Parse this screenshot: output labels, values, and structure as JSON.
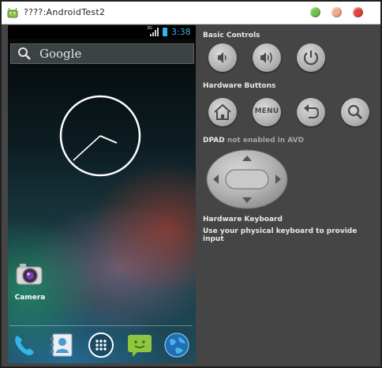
{
  "window": {
    "title": "????:AndroidTest2"
  },
  "statusbar": {
    "network": "3G",
    "time": "3:38"
  },
  "home": {
    "search_label": "Google",
    "camera_label": "Camera"
  },
  "dock": [
    "phone-icon",
    "contacts-icon",
    "app-drawer-icon",
    "messaging-icon",
    "browser-globe-icon"
  ],
  "controls": {
    "basic_title": "Basic Controls",
    "hardware_title": "Hardware Buttons",
    "menu_label": "MENU",
    "dpad_title": "DPAD",
    "dpad_note": "not enabled in AVD",
    "keyboard_title": "Hardware Keyboard",
    "keyboard_hint": "Use your physical keyboard to provide input"
  },
  "colors": {
    "accent": "#33b5e5",
    "panel_bg": "#454545"
  }
}
